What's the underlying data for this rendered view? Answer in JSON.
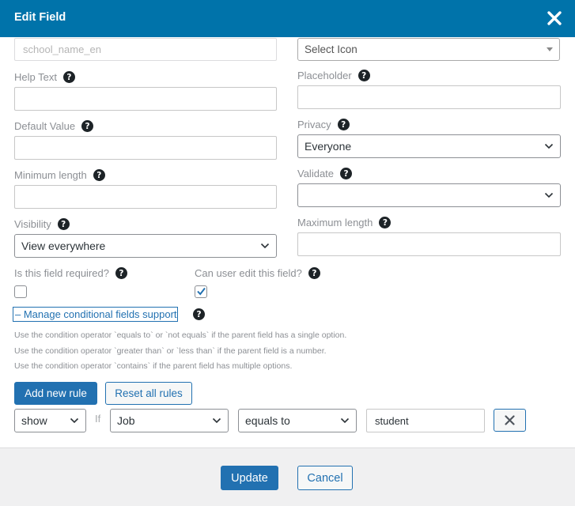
{
  "header": {
    "title": "Edit Field"
  },
  "field_key": {
    "placeholder": "school_name_en"
  },
  "icon_select": {
    "value": "Select Icon"
  },
  "help_text": {
    "label": "Help Text",
    "value": ""
  },
  "placeholder_field": {
    "label": "Placeholder",
    "value": ""
  },
  "default_value": {
    "label": "Default Value",
    "value": ""
  },
  "privacy": {
    "label": "Privacy",
    "value": "Everyone"
  },
  "min_length": {
    "label": "Minimum length",
    "value": ""
  },
  "validate": {
    "label": "Validate",
    "value": ""
  },
  "visibility": {
    "label": "Visibility",
    "value": "View everywhere"
  },
  "max_length": {
    "label": "Maximum length",
    "value": ""
  },
  "required": {
    "label": "Is this field required?",
    "checked": false
  },
  "user_edit": {
    "label": "Can user edit this field?",
    "checked": true
  },
  "conditional": {
    "toggle_label": "– Manage conditional fields support",
    "notes": [
      "Use the condition operator `equals to` or `not equals` if the parent field has a single option.",
      "Use the condition operator `greater than` or `less than` if the parent field is a number.",
      "Use the condition operator `contains` if the parent field has multiple options."
    ],
    "add_rule_label": "Add new rule",
    "reset_label": "Reset all rules",
    "rule": {
      "action": "show",
      "if_label": "If",
      "field": "Job",
      "operator": "equals to",
      "value": "student"
    }
  },
  "footer": {
    "update_label": "Update",
    "cancel_label": "Cancel"
  },
  "colors": {
    "header": "#0073aa",
    "primary": "#2271b1",
    "footer_bg": "#f0f0f1"
  },
  "icons": {
    "close": "close-icon",
    "help": "help-icon",
    "chevron": "chevron-down-icon",
    "check": "check-icon",
    "remove": "remove-rule-icon"
  }
}
